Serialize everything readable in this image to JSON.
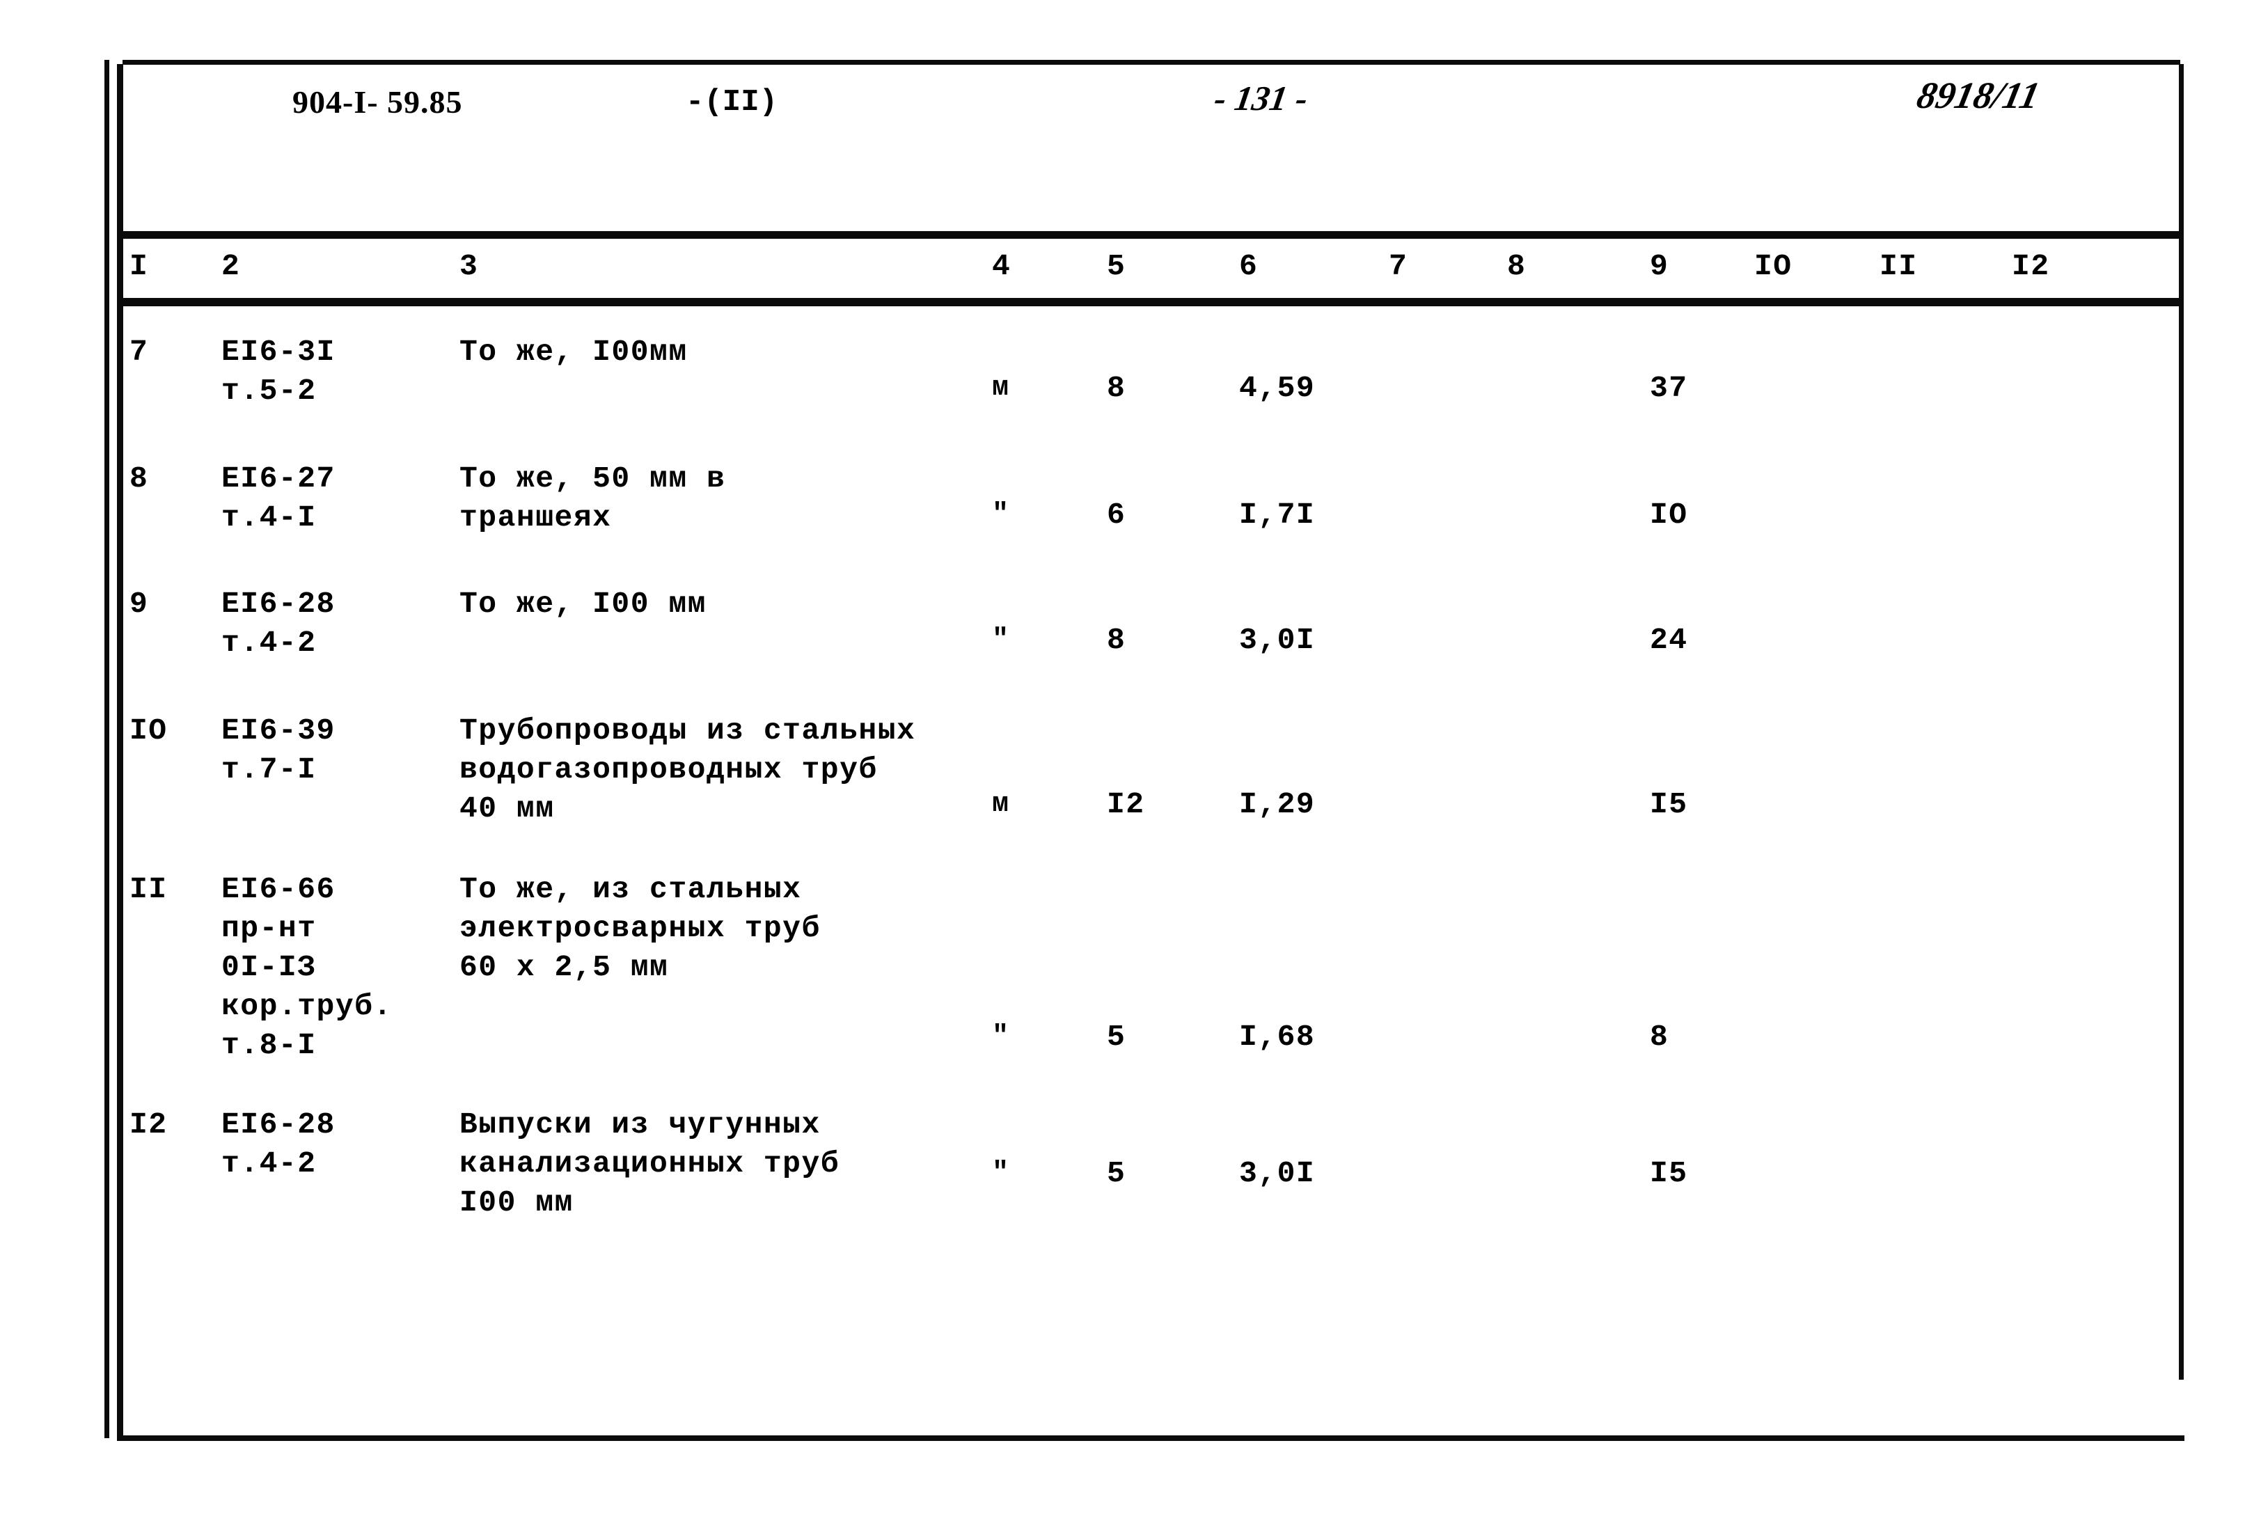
{
  "header": {
    "document_code": "904-I- 59.85",
    "part": "-(II)",
    "page_number": "- 131 -",
    "stamp": "8918/11"
  },
  "table": {
    "column_headers": [
      "I",
      "2",
      "3",
      "4",
      "5",
      "6",
      "7",
      "8",
      "9",
      "IO",
      "II",
      "I2"
    ],
    "rows": [
      {
        "num": "7",
        "code": "ЕІ6-3І\nт.5-2",
        "description": "То же, I00мм",
        "unit": "м",
        "col5": "8",
        "col6": "4,59",
        "col7": "",
        "col8": "",
        "col9": "37",
        "col10": "",
        "col11": "",
        "col12": ""
      },
      {
        "num": "8",
        "code": "ЕІ6-27\nт.4-І",
        "description": "То же, 50 мм в\nтраншеях",
        "unit": "\"",
        "col5": "6",
        "col6": "I,7I",
        "col7": "",
        "col8": "",
        "col9": "IO",
        "col10": "",
        "col11": "",
        "col12": ""
      },
      {
        "num": "9",
        "code": "ЕІ6-28\nт.4-2",
        "description": "То же, I00 мм",
        "unit": "\"",
        "col5": "8",
        "col6": "3,0I",
        "col7": "",
        "col8": "",
        "col9": "24",
        "col10": "",
        "col11": "",
        "col12": ""
      },
      {
        "num": "IO",
        "code": "ЕІ6-39\nт.7-І",
        "description": "Трубопроводы из стальных\nводогазопроводных труб\n40 мм",
        "unit": "м",
        "col5": "I2",
        "col6": "I,29",
        "col7": "",
        "col8": "",
        "col9": "I5",
        "col10": "",
        "col11": "",
        "col12": ""
      },
      {
        "num": "II",
        "code": "ЕІ6-66\nпр-нт\n0І-ІЗ\nкор.труб.\nт.8-І",
        "description": "То же, из стальных\nэлектросварных труб\n60 х 2,5 мм",
        "unit": "\"",
        "col5": "5",
        "col6": "I,68",
        "col7": "",
        "col8": "",
        "col9": "8",
        "col10": "",
        "col11": "",
        "col12": ""
      },
      {
        "num": "I2",
        "code": "ЕІ6-28\nт.4-2",
        "description": "Выпуски из чугунных\nканализационных труб\nI00 мм",
        "unit": "\"",
        "col5": "5",
        "col6": "3,0I",
        "col7": "",
        "col8": "",
        "col9": "I5",
        "col10": "",
        "col11": "",
        "col12": ""
      }
    ]
  }
}
